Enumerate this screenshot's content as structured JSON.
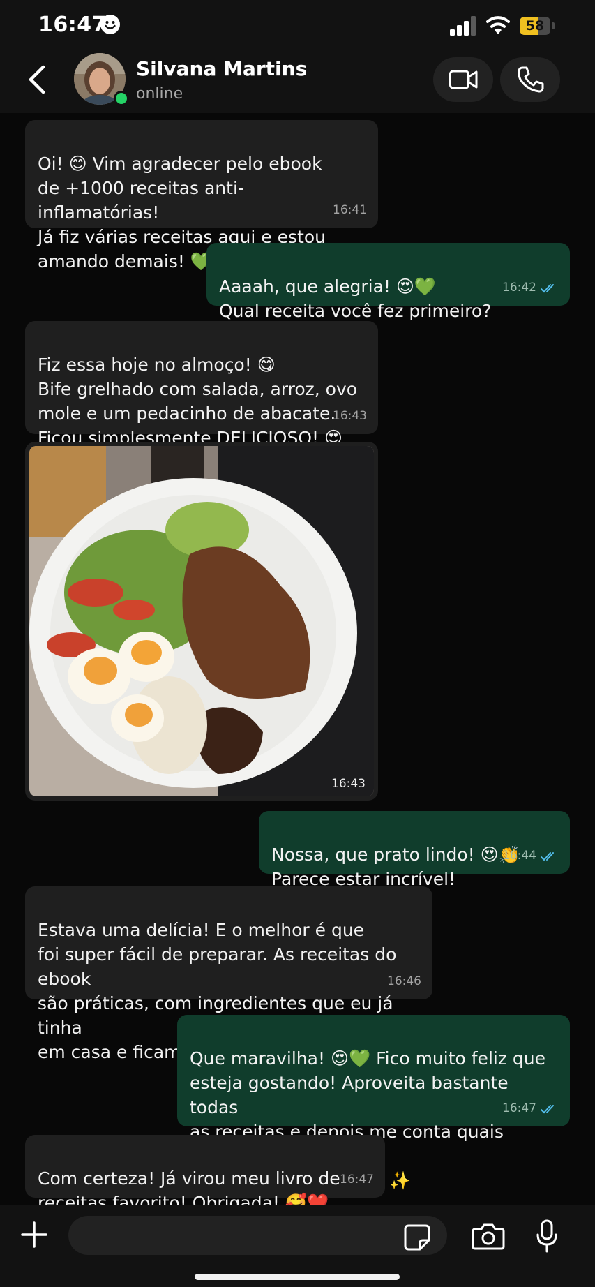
{
  "status_bar": {
    "time": "16:47",
    "battery": "58",
    "battery_level": 0.58
  },
  "header": {
    "contact_name": "Silvana Martins",
    "contact_status": "online",
    "icons": [
      "back-icon",
      "video-call-icon",
      "phone-icon"
    ]
  },
  "messages": [
    {
      "direction": "in",
      "text": "Oi! 😊 Vim agradecer pelo ebook\nde +1000 receitas anti-inflamatórias!\nJá fiz várias receitas aqui e estou\namando demais! 💚",
      "time": "16:41"
    },
    {
      "direction": "out",
      "text": "Aaaah, que alegria! 😍💚\nQual receita você fez primeiro?",
      "time": "16:42",
      "status": "read"
    },
    {
      "direction": "in",
      "text": "Fiz essa hoje no almoço! 😋\nBife grelhado com salada, arroz, ovo\nmole e um pedacinho de abacate.\nFicou simplesmente DELICIOSO! 😍",
      "time": "16:43"
    },
    {
      "direction": "in",
      "type": "image",
      "time": "16:43"
    },
    {
      "direction": "out",
      "text": "Nossa, que prato lindo! 😍👏\nParece estar incrível!",
      "time": "16:44",
      "status": "read"
    },
    {
      "direction": "in",
      "text": "Estava uma delícia! E o melhor é que\nfoi super fácil de preparar. As receitas do ebook\nsão práticas, com ingredientes que eu já tinha\nem casa e ficam muito saborosas! 👏🏽💚",
      "time": "16:46"
    },
    {
      "direction": "out",
      "text": "Que maravilha! 😍💚 Fico muito feliz que\nesteja gostando! Aproveita bastante todas\nas receitas e depois me conta quais foram\nas próximas favoritas! ✨",
      "time": "16:47",
      "status": "read"
    },
    {
      "direction": "in",
      "text": "Com certeza! Já virou meu livro de\nreceitas favorito! Obrigada! 🥰❤️",
      "time": "16:47"
    }
  ],
  "input_bar": {
    "value": "",
    "icons": [
      "plus-icon",
      "sticker-icon",
      "camera-icon",
      "microphone-icon"
    ]
  },
  "colors": {
    "incoming_bubble": "#1f1f1f",
    "outgoing_bubble": "#103d2c",
    "read_tick": "#53bdeb",
    "online": "#25d366"
  }
}
